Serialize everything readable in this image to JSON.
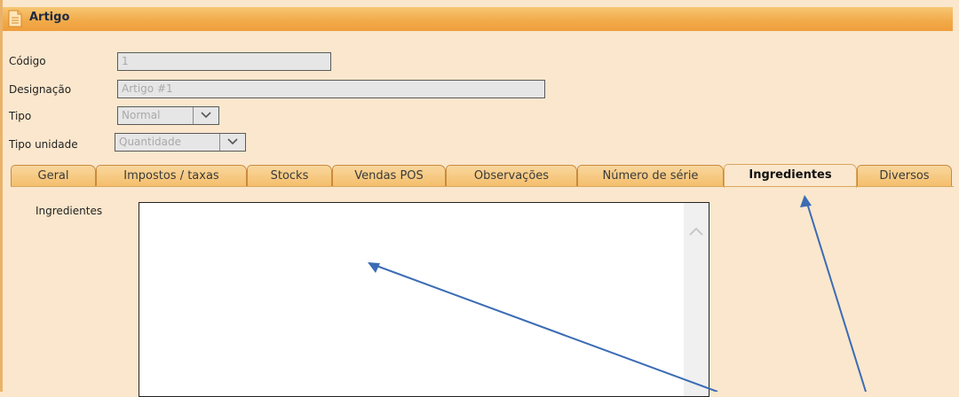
{
  "window": {
    "title": "Artigo",
    "icon": "document-icon"
  },
  "form": {
    "codigo": {
      "label": "Código",
      "value": "1"
    },
    "designacao": {
      "label": "Designação",
      "value": "Artigo #1"
    },
    "tipo": {
      "label": "Tipo",
      "value": "Normal"
    },
    "tipo_unidade": {
      "label": "Tipo unidade",
      "value": "Quantidade"
    }
  },
  "tabs": [
    {
      "label": "Geral"
    },
    {
      "label": "Impostos / taxas"
    },
    {
      "label": "Stocks"
    },
    {
      "label": "Vendas POS"
    },
    {
      "label": "Observações"
    },
    {
      "label": "Número de série"
    },
    {
      "label": "Ingredientes",
      "active": true
    },
    {
      "label": "Diversos"
    }
  ],
  "panel": {
    "ingredientes_label": "Ingredientes",
    "ingredientes_value": ""
  },
  "colors": {
    "header": "#f2ab4a",
    "background": "#fbe7cd",
    "annotation_arrow": "#3b6cb4"
  }
}
